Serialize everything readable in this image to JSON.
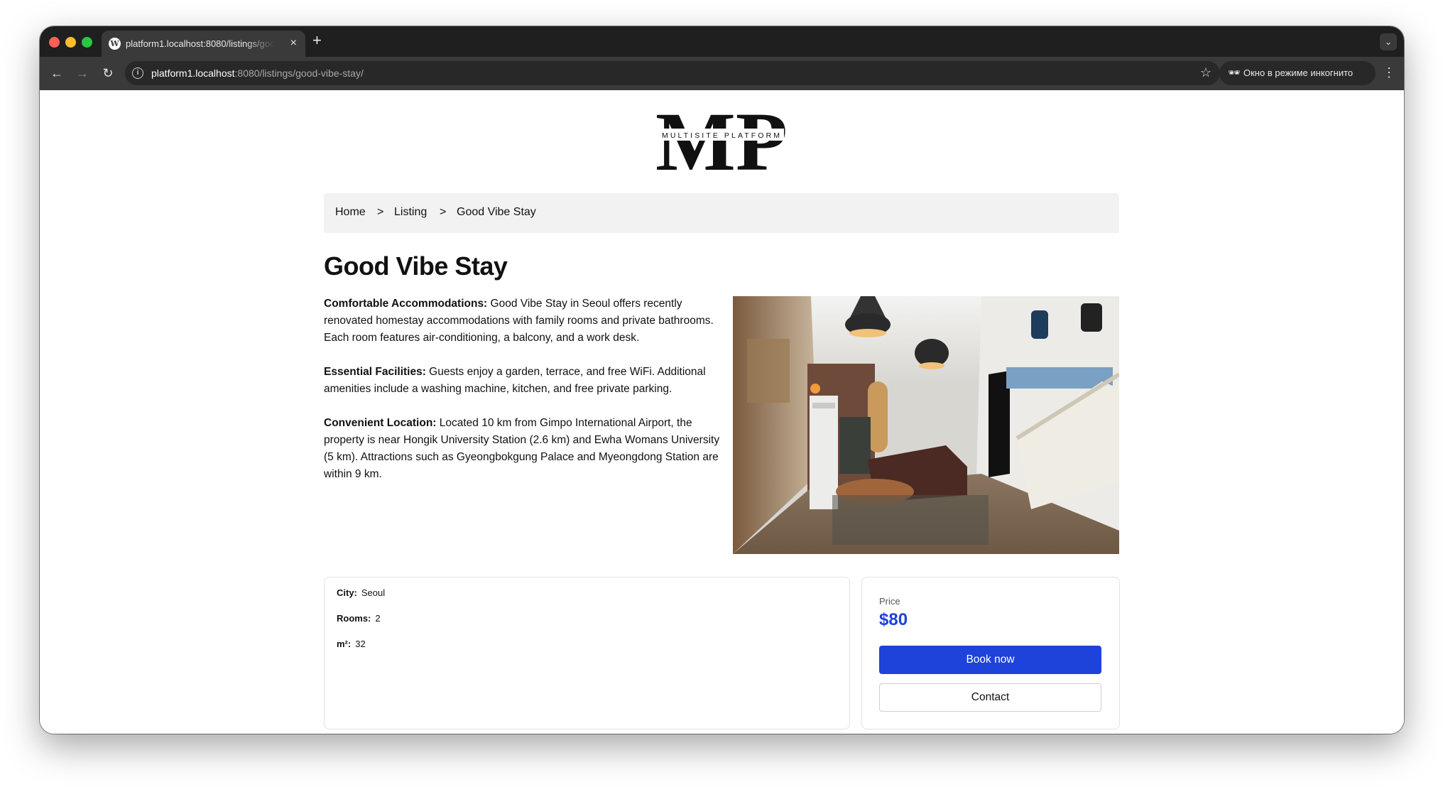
{
  "browser": {
    "tab": {
      "title": "platform1.localhost:8080/listings/good-vibe-stay/",
      "favicon": "wordpress-icon",
      "close": "×"
    },
    "new_tab": "+",
    "tab_menu": "⌄",
    "url": {
      "host": "platform1.localhost",
      "rest": ":8080/listings/good-vibe-stay/"
    },
    "incognito_label": "Окно в режиме инкогнито",
    "icons": {
      "back": "←",
      "forward": "→",
      "reload": "↻",
      "info": "i",
      "bookmark": "☆",
      "incognito": "🕶",
      "menu": "⋮"
    }
  },
  "site": {
    "logo": {
      "letters": "MP",
      "tagline": "MULTISITE PLATFORM"
    }
  },
  "breadcrumb": {
    "home": "Home",
    "separator": ">",
    "listing": "Listing",
    "current": "Good Vibe Stay"
  },
  "listing": {
    "title": "Good Vibe Stay",
    "paragraphs": [
      {
        "heading": "Comfortable Accommodations:",
        "text": " Good Vibe Stay in Seoul offers recently renovated homestay accommodations with family rooms and private bathrooms. Each room features air-conditioning, a balcony, and a work desk."
      },
      {
        "heading": "Essential Facilities:",
        "text": " Guests enjoy a garden, terrace, and free WiFi. Additional amenities include a washing machine, kitchen, and free private parking."
      },
      {
        "heading": "Convenient Location:",
        "text": " Located 10 km from Gimpo International Airport, the property is near Hongik University Station (2.6 km) and Ewha Womans University (5 km). Attractions such as Gyeongbokgung Palace and Myeongdong Station are within 9 km."
      }
    ],
    "details": [
      {
        "label": "City:",
        "value": "Seoul"
      },
      {
        "label": "Rooms:",
        "value": "2"
      },
      {
        "label": "m²:",
        "value": "32"
      }
    ]
  },
  "booking": {
    "price_label": "Price",
    "price": "$80",
    "book_label": "Book now",
    "contact_label": "Contact",
    "accent_color": "#1d43db"
  }
}
